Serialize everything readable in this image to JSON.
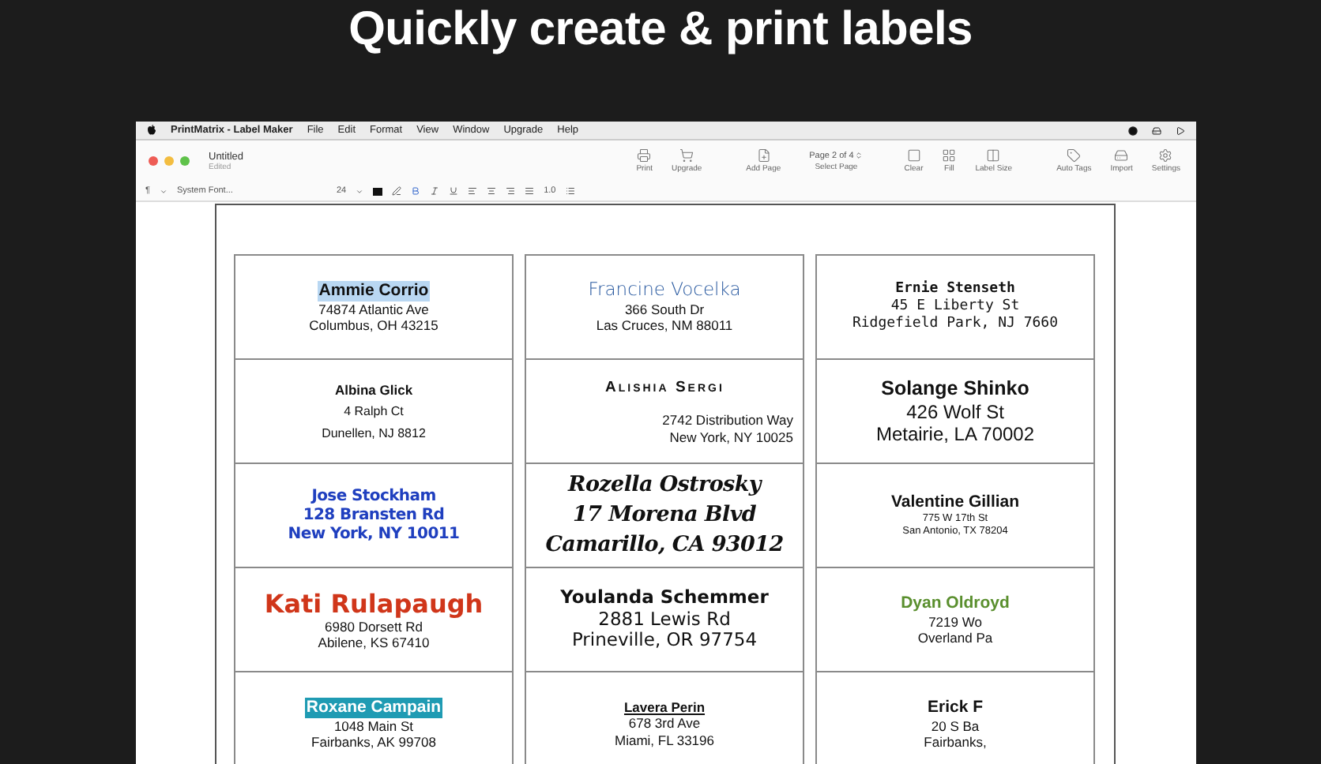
{
  "headline": "Quickly create & print labels",
  "menu_bar": {
    "app_name": "PrintMatrix - Label Maker",
    "items": [
      "File",
      "Edit",
      "Format",
      "View",
      "Window",
      "Upgrade",
      "Help"
    ]
  },
  "window": {
    "title": "Untitled",
    "subtitle": "Edited"
  },
  "toolbar": [
    {
      "kind": "print",
      "label": "Print"
    },
    {
      "kind": "upgrade",
      "label": "Upgrade"
    },
    {
      "kind": "add-page",
      "label": "Add Page"
    },
    {
      "kind": "page-select",
      "value": "Page 2 of 4",
      "label": "Select Page"
    },
    {
      "kind": "clear",
      "label": "Clear"
    },
    {
      "kind": "fill",
      "label": "Fill"
    },
    {
      "kind": "label-size",
      "label": "Label Size"
    },
    {
      "kind": "auto-tags",
      "label": "Auto Tags"
    },
    {
      "kind": "import",
      "label": "Import"
    },
    {
      "kind": "settings",
      "label": "Settings"
    }
  ],
  "format_bar": {
    "paragraph": "¶",
    "font": "System Font...",
    "size": "24",
    "line_spacing": "1.0"
  },
  "labels": [
    {
      "kind": "sans",
      "color": "#111111",
      "highlighted": true,
      "highlight": {
        "color": "#b9d7f2"
      },
      "lines": [
        "Ammie Corrio",
        "74874 Atlantic Ave",
        "Columbus, OH 43215"
      ]
    },
    {
      "kind": "light",
      "color": "#2a5aa0",
      "highlighted": false,
      "lines": [
        "Francine Vocelka",
        "366 South Dr",
        "Las Cruces, NM 88011"
      ]
    },
    {
      "kind": "mono",
      "color": "#111111",
      "highlighted": false,
      "lines": [
        "Ernie Stenseth",
        "45 E Liberty St",
        "Ridgefield Park, NJ 7660"
      ]
    },
    {
      "kind": "spaced",
      "color": "#111111",
      "highlighted": false,
      "lines": [
        "Albina Glick",
        "4 Ralph Ct",
        "Dunellen, NJ 8812"
      ]
    },
    {
      "kind": "caps-right",
      "color": "#111111",
      "highlighted": false,
      "lines": [
        "Alishia Sergi",
        "2742 Distribution Way",
        "New York, NY 10025"
      ]
    },
    {
      "kind": "large",
      "color": "#111111",
      "highlighted": false,
      "lines": [
        "Solange Shinko",
        "426 Wolf St",
        "Metairie, LA 70002"
      ]
    },
    {
      "kind": "condensed",
      "color": "#1f3fbf",
      "highlighted": false,
      "lines": [
        "Jose Stockham",
        "128 Bransten Rd",
        "New York, NY 10011"
      ]
    },
    {
      "kind": "script",
      "color": "#111111",
      "highlighted": false,
      "lines": [
        "Rozella Ostrosky",
        "17 Morena Blvd",
        "Camarillo, CA 93012"
      ]
    },
    {
      "kind": "tiny-address",
      "color": "#111111",
      "highlighted": false,
      "lines": [
        "Valentine Gillian",
        "775 W 17th St",
        "San Antonio, TX 78204"
      ]
    },
    {
      "kind": "big-name",
      "color": "#d0361a",
      "highlighted": false,
      "lines": [
        "Kati Rulapaugh",
        "6980 Dorsett Rd",
        "Abilene, KS 67410"
      ]
    },
    {
      "kind": "geometric",
      "color": "#111111",
      "highlighted": false,
      "lines": [
        "Youlanda Schemmer",
        "2881 Lewis Rd",
        "Prineville, OR 97754"
      ]
    },
    {
      "kind": "sans",
      "color": "#5a8f2e",
      "highlighted": false,
      "lines": [
        "Dyan Oldroyd",
        "7219 Wo",
        "Overland Pa"
      ]
    },
    {
      "kind": "sans",
      "highlighted": true,
      "highlight": {
        "color": "#1f9bb3"
      },
      "lines": [
        "Roxane Campain",
        "1048 Main St",
        "Fairbanks, AK 99708"
      ]
    },
    {
      "kind": "underlined",
      "color": "#111111",
      "highlighted": false,
      "lines": [
        "Lavera Perin",
        "678 3rd Ave",
        "Miami, FL 33196"
      ]
    },
    {
      "kind": "sans",
      "color": "#111111",
      "highlighted": false,
      "lines": [
        "Erick F",
        "20 S Ba",
        "Fairbanks,"
      ]
    }
  ]
}
